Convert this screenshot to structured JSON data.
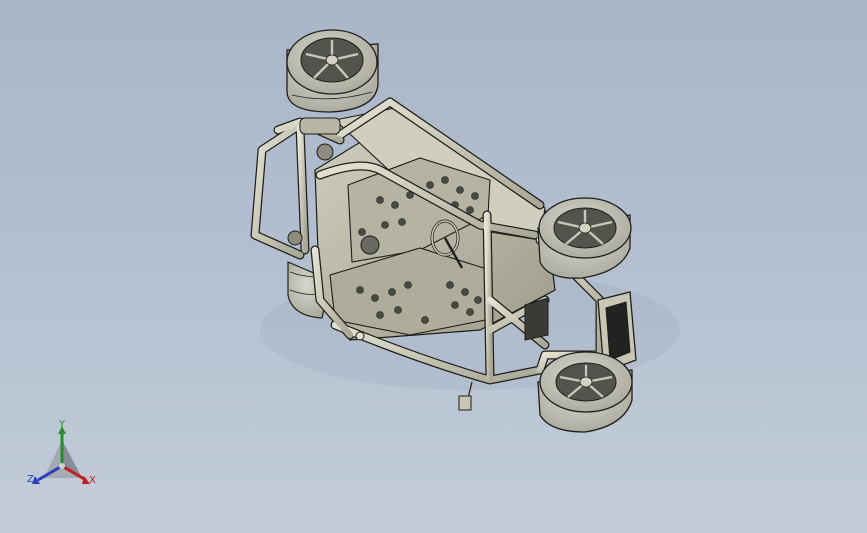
{
  "viewport": {
    "background_top": "#a9b6c8",
    "background_bottom": "#c2ccd9"
  },
  "model": {
    "description_icon": "go-kart-chassis-model",
    "tube_color": "#c8c6b4",
    "tube_edge_color": "#1e1e1a",
    "plate_color": "#b9b7a6",
    "tire_color": "#c5c4b8",
    "rim_color": "#4b4b46"
  },
  "triad": {
    "x_label": "X",
    "y_label": "Y",
    "z_label": "Z",
    "x_color": "#c02020",
    "y_color": "#2b8a2b",
    "z_color": "#2b3fb8"
  }
}
